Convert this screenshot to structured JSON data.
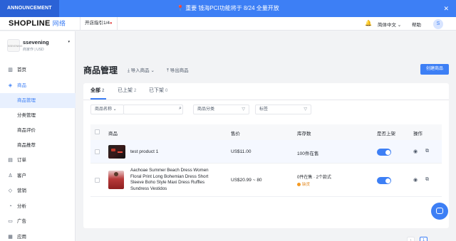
{
  "announcement": {
    "tag": "ANNOUNCEMENT",
    "pin": "📍",
    "text": "重要  钱海PCI功能将于 8/24 全量开放",
    "close": "✕"
  },
  "topbar": {
    "logo": "SHOPLINE",
    "logo_sub": "网络",
    "guide": "开店指引1/4",
    "guide_dot": "●",
    "bell_icon": "🔔",
    "language": "简体中文 ⌄",
    "help": "帮助",
    "avatar": "S"
  },
  "store": {
    "logo": "SSEVENING",
    "name": "ssevening",
    "plan": "商家作 | USD",
    "caret": "▾"
  },
  "sidebar": {
    "items": [
      {
        "icon": "▥",
        "label": "首页"
      },
      {
        "icon": "◈",
        "label": "商品"
      },
      {
        "label": "商品管理"
      },
      {
        "label": "分类管理"
      },
      {
        "label": "商品评价"
      },
      {
        "label": "商品推荐"
      },
      {
        "icon": "▤",
        "label": "订单"
      },
      {
        "icon": "♙",
        "label": "客户"
      },
      {
        "icon": "◇",
        "label": "营销"
      },
      {
        "icon": "◔",
        "label": "分析"
      },
      {
        "icon": "▭",
        "label": "广告"
      },
      {
        "icon": "▦",
        "label": "应用"
      }
    ]
  },
  "page": {
    "title": "商品管理",
    "import_label": "⤓  导入商品 ⌄",
    "export_label": "⤒  导出商品",
    "create_button": "创建商品"
  },
  "tabs": [
    {
      "label": "全部",
      "count": "2"
    },
    {
      "label": "已上架",
      "count": "2"
    },
    {
      "label": "已下架",
      "count": "0"
    }
  ],
  "filters": {
    "name_select": "商品名称 ⌄",
    "search_icon": "⌕",
    "category": "商品分类",
    "tag": "标签",
    "funnel_icon": "▽"
  },
  "table": {
    "headers": {
      "product": "商品",
      "price": "售价",
      "stock": "库存数",
      "published": "是否上架",
      "actions": "操作"
    },
    "rows": [
      {
        "name": "test product 1",
        "price": "US$11.00",
        "stock": "100件在售",
        "stock_note": ""
      },
      {
        "name_lines": [
          "Aachoae Summer Beach Dress Women",
          "Floral Print Long Bohemian Dress Short",
          "Sleeve Boho Style Maxi Dress Ruffles",
          "Sundress Vestidos"
        ],
        "price": "US$20.99 ~ 80",
        "stock": "0件在售 · 2个款式",
        "stock_note": "缺货"
      }
    ],
    "view_icon": "◉",
    "copy_icon": "⧉"
  },
  "pagination": {
    "prev": "‹",
    "current": "1"
  },
  "colors": {
    "primary": "#3d7ff5",
    "announcement_bg": "#3d7ff5",
    "warning": "#f59a23"
  }
}
